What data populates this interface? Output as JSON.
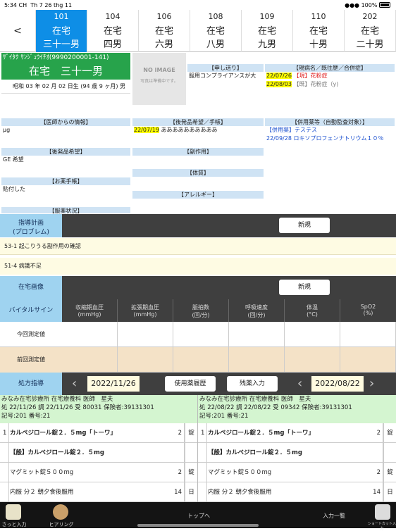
{
  "status": {
    "time": "5:34 CH",
    "date": "Th 7 26 thg 11",
    "battery": "100%"
  },
  "tabs": [
    {
      "num": "101",
      "l1": "在宅",
      "l2": "三十一男",
      "selected": true
    },
    {
      "num": "104",
      "l1": "在宅",
      "l2": "四男"
    },
    {
      "num": "106",
      "l1": "在宅",
      "l2": "六男"
    },
    {
      "num": "108",
      "l1": "在宅",
      "l2": "八男"
    },
    {
      "num": "109",
      "l1": "在宅",
      "l2": "九男"
    },
    {
      "num": "110",
      "l1": "在宅",
      "l2": "十男"
    },
    {
      "num": "202",
      "l1": "在宅",
      "l2": "二十男"
    }
  ],
  "back_label": "<",
  "patient": {
    "kana": "ｻﾞｲﾀｸ ｻﾝｼﾞｭｳｲﾁｵ(9990200001-141)",
    "name": "在宅　三十一男",
    "birth": "昭和 03 年 02 月 02 日生 (94 歳 9 ヶ月) 男"
  },
  "noimage": {
    "title": "NO IMAGE",
    "sub": "写真は準備中です。"
  },
  "memo": {
    "header": "【申し送り】",
    "text": "服用コンプライアンスが大"
  },
  "disease": {
    "header": "【現病名／既往歴／合併症】",
    "items": [
      {
        "date": "22/07/26",
        "tag": "【現】",
        "name": "花粉症"
      },
      {
        "date": "22/08/03",
        "tag": "【既】",
        "name": "花粉症（y)"
      }
    ]
  },
  "doctor": {
    "header": "【医師からの情報】",
    "text": "μg"
  },
  "generic": {
    "header": "【後発品希望】",
    "text": "GE 希望"
  },
  "handbook": {
    "header": "【お薬手帳】",
    "text": "貼付した"
  },
  "status_med": {
    "header": "【服薬状況】"
  },
  "generic_memo": {
    "header": "【後発品希望／手帳】",
    "date": "22/07/19",
    "text": "ああああああああああ"
  },
  "side_effect": {
    "header": "【副作用】"
  },
  "constitution": {
    "header": "【体質】"
  },
  "allergy": {
    "header": "【アレルギー】"
  },
  "combined": {
    "header": "【併用薬等（自動監査対象）】",
    "l1_tag": "【併用薬】",
    "l1_name": "テステス",
    "l2_date": "22/09/28",
    "l2_name": "ロキソプロフェンナトリウム１０％"
  },
  "plan": {
    "label1": "指導計画",
    "label2": "(プロブレム)",
    "new": "新規",
    "items": [
      "53-1 起こりうる副作用の確認",
      "51-4 病識不足"
    ]
  },
  "image": {
    "label": "在宅画像",
    "new": "新規"
  },
  "vital": {
    "label": "バイタルサイン",
    "cols": [
      {
        "t": "収縮期血圧",
        "u": "(mmHg)"
      },
      {
        "t": "拡張期血圧",
        "u": "(mmHg)"
      },
      {
        "t": "脈拍数",
        "u": "(回/分)"
      },
      {
        "t": "呼吸速度",
        "u": "(回/分)"
      },
      {
        "t": "体温",
        "u": "(°C)"
      },
      {
        "t": "SpO2",
        "u": "(%)"
      }
    ],
    "row1": "今回測定値",
    "row2": "前回測定値"
  },
  "rx": {
    "label": "処方指導",
    "date1": "2022/11/26",
    "history": "使用薬履歴",
    "remain": "残薬入力",
    "date2": "2022/08/22",
    "left": {
      "l1": "みなみ在宅診療所 在宅療養科 医師　星夫",
      "l2": "処 22/11/26 調 22/11/26 受 80031 保険者:39131301",
      "l3": "記号:201 番号:21"
    },
    "right": {
      "l1": "みなみ在宅診療所 在宅療養科 医師　星夫",
      "l2": "処 22/08/22 調 22/08/22 受 09342 保険者:39131301",
      "l3": "記号:201 番号:21"
    },
    "rows": [
      {
        "no": "1",
        "name": "カルベジロール錠２．５mg「トーワ」",
        "qty": "2",
        "unit": "錠",
        "bold": true
      },
      {
        "no": "",
        "name": "【般】カルベジロール錠２．５mg",
        "qty": "",
        "unit": "",
        "bold": true
      },
      {
        "no": "",
        "name": "マグミット錠５００mg",
        "qty": "2",
        "unit": "錠",
        "bold": false
      },
      {
        "no": "",
        "name": "内服 分２ 朝夕食後服用",
        "qty": "14",
        "unit": "日",
        "bold": false
      }
    ]
  },
  "bottom": {
    "b1": "さっと入力",
    "b2": "ヒアリング",
    "b3": "トップへ",
    "b4": "入力一覧",
    "b5": "ショートカット入力"
  }
}
